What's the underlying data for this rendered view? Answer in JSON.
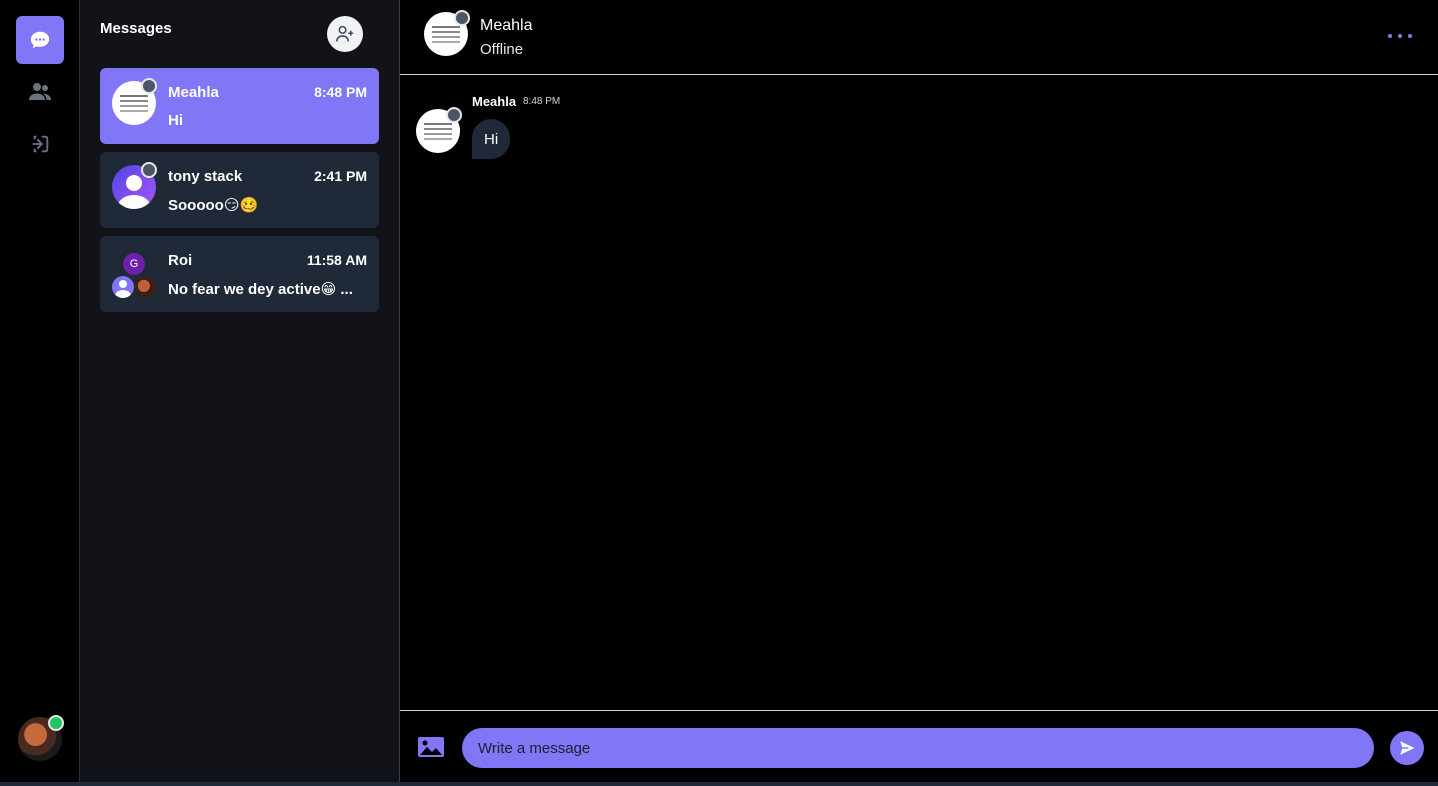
{
  "sidebar": {
    "icons": [
      "chat-bubble-icon",
      "friends-icon",
      "logout-icon"
    ],
    "accent_color": "#8176f5",
    "user_status": "online"
  },
  "list": {
    "title": "Messages",
    "conversations": [
      {
        "name": "Meahla",
        "time": "8:48 PM",
        "preview": "Hi",
        "selected": true,
        "status": "offline"
      },
      {
        "name": "tony stack",
        "time": "2:41 PM",
        "preview": "Sooooo😏🥴",
        "selected": false,
        "status": "offline"
      },
      {
        "name": "Roi",
        "time": "11:58 AM",
        "preview": "No fear we dey active😁 ...",
        "selected": false,
        "group_badge": "G"
      }
    ]
  },
  "chat": {
    "contact_name": "Meahla",
    "contact_status": "Offline",
    "messages": [
      {
        "sender": "Meahla",
        "time": "8:48 PM",
        "text": "Hi"
      }
    ],
    "composer": {
      "placeholder": "Write a message"
    }
  }
}
